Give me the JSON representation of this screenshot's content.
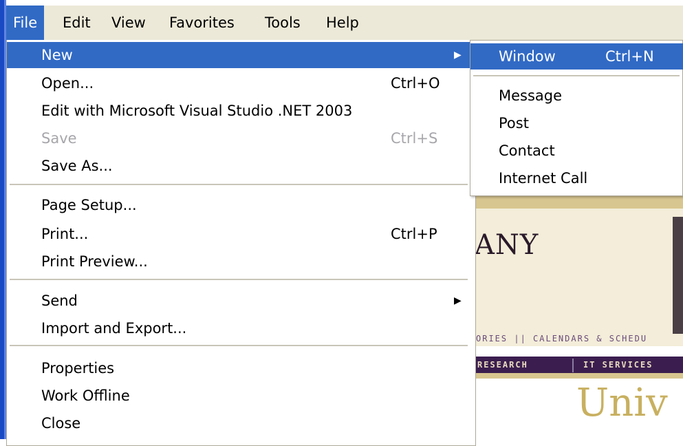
{
  "menubar": {
    "items": [
      "File",
      "Edit",
      "View",
      "Favorites",
      "Tools",
      "Help"
    ],
    "active": "File"
  },
  "file_menu": {
    "items": [
      {
        "label": "New",
        "shortcut": "",
        "submenu": true,
        "highlighted": true
      },
      {
        "label": "Open...",
        "shortcut": "Ctrl+O"
      },
      {
        "label": "Edit with Microsoft Visual Studio .NET 2003",
        "shortcut": ""
      },
      {
        "label": "Save",
        "shortcut": "Ctrl+S",
        "disabled": true
      },
      {
        "label": "Save As...",
        "shortcut": ""
      },
      {
        "label": "Page Setup...",
        "shortcut": ""
      },
      {
        "label": "Print...",
        "shortcut": "Ctrl+P"
      },
      {
        "label": "Print Preview...",
        "shortcut": ""
      },
      {
        "label": "Send",
        "shortcut": "",
        "submenu": true
      },
      {
        "label": "Import and Export...",
        "shortcut": ""
      },
      {
        "label": "Properties",
        "shortcut": ""
      },
      {
        "label": "Work Offline",
        "shortcut": ""
      },
      {
        "label": "Close",
        "shortcut": ""
      }
    ]
  },
  "new_submenu": {
    "items": [
      {
        "label": "Window",
        "shortcut": "Ctrl+N",
        "highlighted": true
      },
      {
        "label": "Message",
        "shortcut": ""
      },
      {
        "label": "Post",
        "shortcut": ""
      },
      {
        "label": "Contact",
        "shortcut": ""
      },
      {
        "label": "Internet Call",
        "shortcut": ""
      }
    ]
  },
  "background_page": {
    "logo_fragment": "ANY",
    "links_fragment": "ORIES || CALENDARS & SCHEDU",
    "nav_fragment_1": "RESEARCH",
    "nav_fragment_2": "IT SERVICES",
    "heading_fragment": "Univ"
  },
  "colors": {
    "highlight": "#316ac5",
    "menubar_bg": "#ece9d8",
    "disabled_text": "#a7a6aa"
  }
}
